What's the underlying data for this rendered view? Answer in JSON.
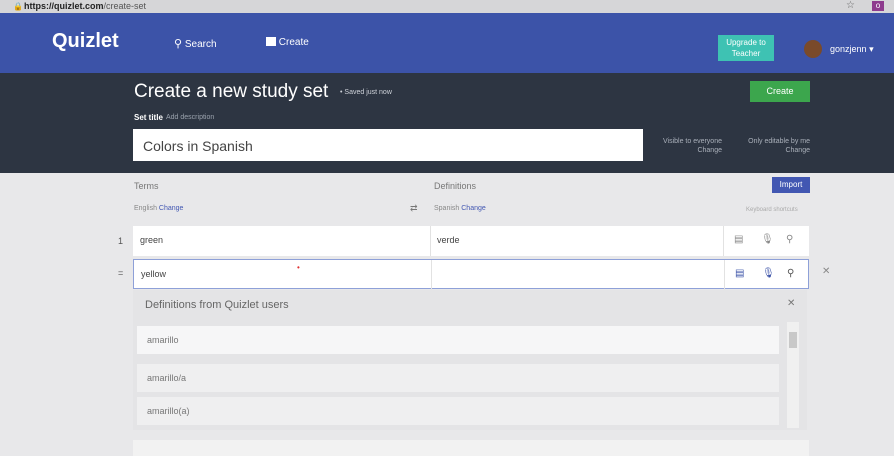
{
  "browser": {
    "url_host": "https://quizlet.com",
    "url_path": "/create-set"
  },
  "nav": {
    "logo": "Quizlet",
    "search": "Search",
    "create": "Create",
    "upgrade_line1": "Upgrade to",
    "upgrade_line2": "Teacher",
    "username": "gonzjenn"
  },
  "header": {
    "title": "Create a new study set",
    "saved": "• Saved just now",
    "create_button": "Create",
    "set_title_label": "Set title",
    "add_description": "Add description",
    "set_title_value": "Colors in Spanish",
    "visible_line1": "Visible to everyone",
    "visible_line2": "Change",
    "editable_line1": "Only editable by me",
    "editable_line2": "Change"
  },
  "columns": {
    "terms": "Terms",
    "definitions": "Definitions",
    "import": "Import",
    "term_lang": "English",
    "term_change": "Change",
    "def_lang": "Spanish",
    "def_change": "Change",
    "keyboard": "Keyboard shortcuts"
  },
  "rows": [
    {
      "num": "1",
      "term": "green",
      "definition": "verde"
    },
    {
      "num": "=",
      "term": "yellow",
      "definition": ""
    }
  ],
  "dropdown": {
    "title": "Definitions from Quizlet users",
    "items": [
      "amarillo",
      "amarillo/a",
      "amarillo(a)"
    ]
  },
  "icons": {
    "image": "image-icon",
    "mic": "microphone-icon",
    "search": "search-icon"
  },
  "colors": {
    "nav": "#3c53a8",
    "header": "#2d3542",
    "create": "#3ca64d",
    "upgrade": "#3ec2b3",
    "accent": "#4257b2"
  }
}
